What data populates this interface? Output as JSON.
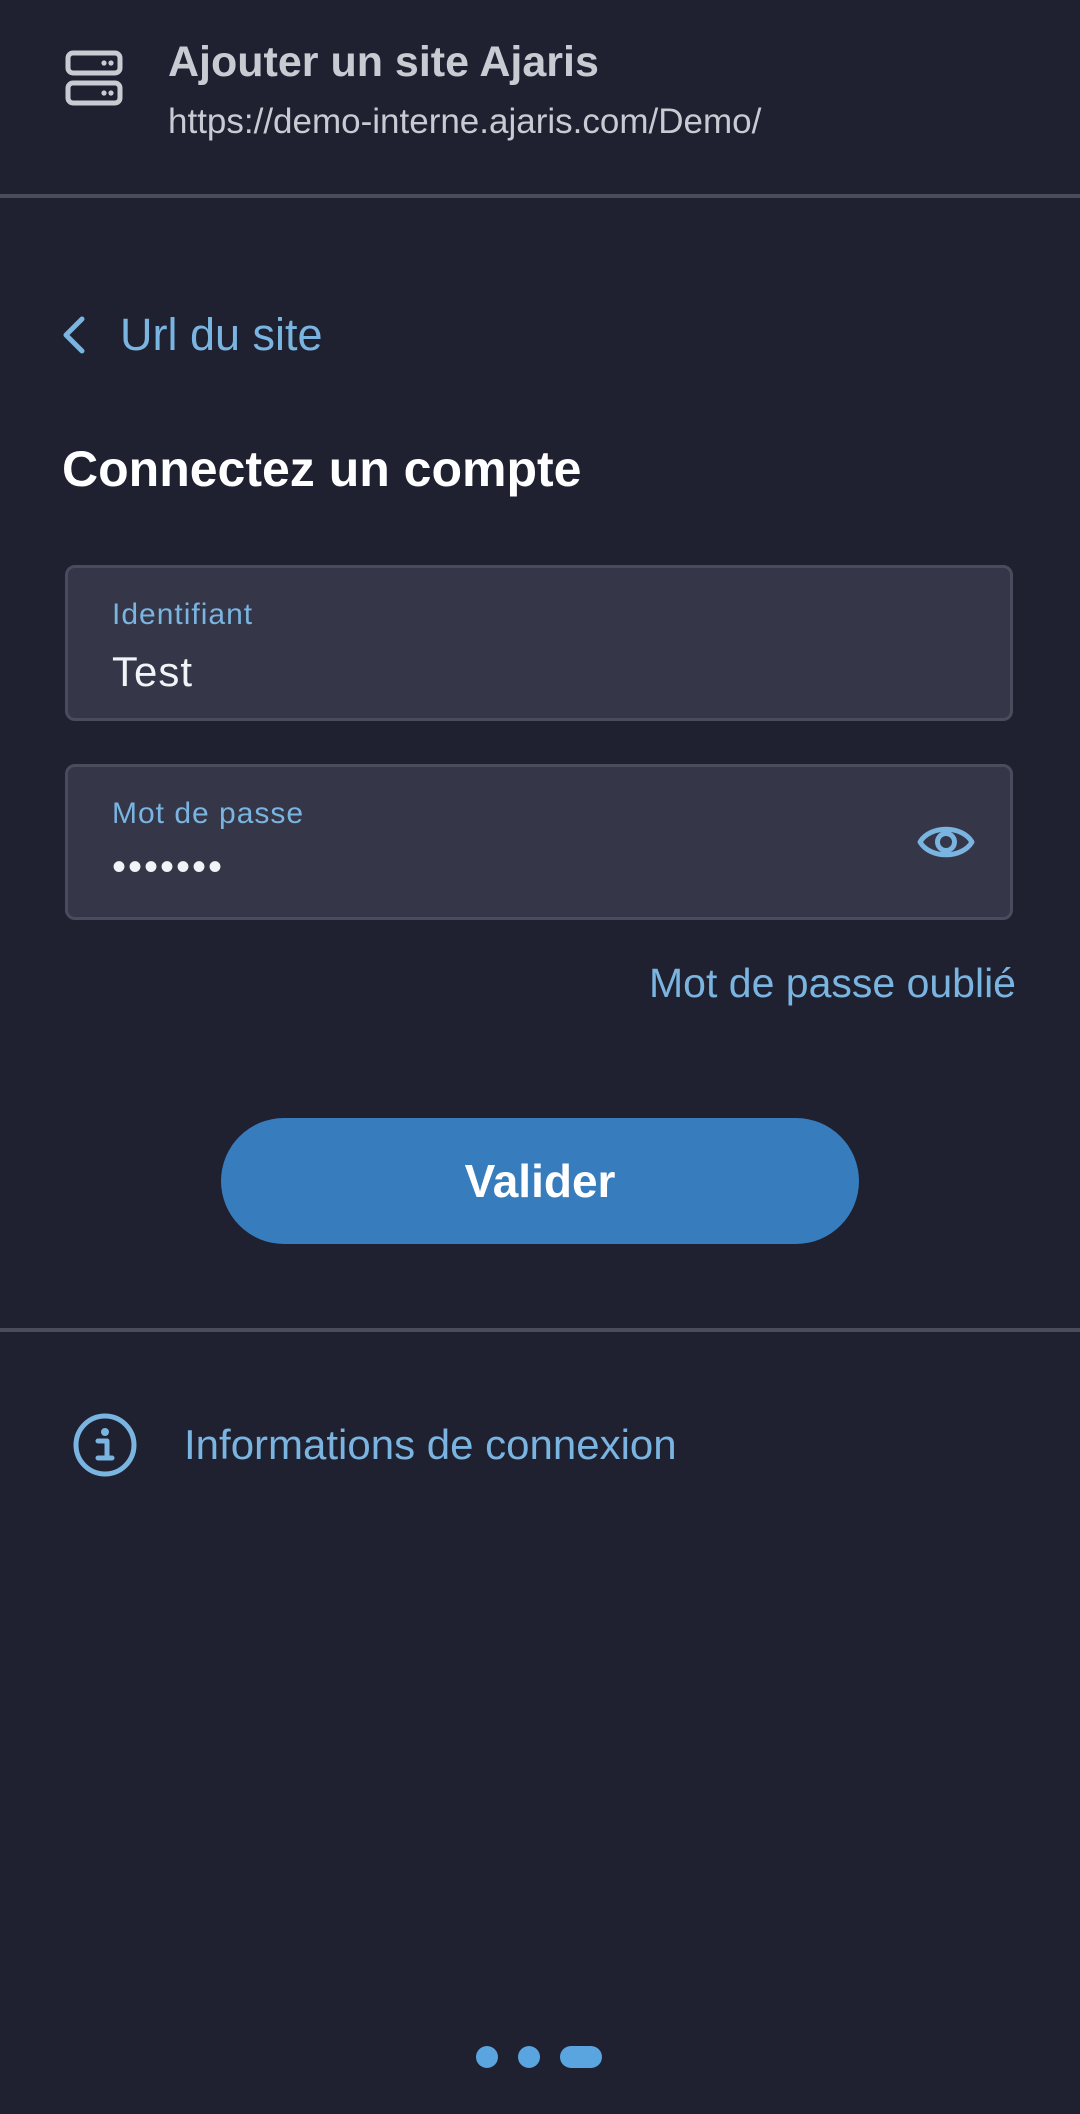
{
  "header": {
    "title": "Ajouter un site Ajaris",
    "url": "https://demo-interne.ajaris.com/Demo/",
    "icon": "server-icon"
  },
  "back": {
    "label": "Url du site",
    "icon": "chevron-left-icon"
  },
  "login": {
    "title": "Connectez un compte",
    "username": {
      "label": "Identifiant",
      "value": "Test"
    },
    "password": {
      "label": "Mot de passe",
      "masked_value": "•••••••",
      "toggle_icon": "eye-icon"
    },
    "forgot_label": "Mot de passe oublié",
    "submit_label": "Valider"
  },
  "info": {
    "label": "Informations de connexion",
    "icon": "info-circle-icon"
  },
  "pagination": {
    "total_steps": 3,
    "current_step": 3
  },
  "colors": {
    "background": "#1f2030",
    "field_background": "#353648",
    "accent": "#7ab4e0",
    "button": "#377cbd",
    "divider": "#4a4c5c"
  }
}
